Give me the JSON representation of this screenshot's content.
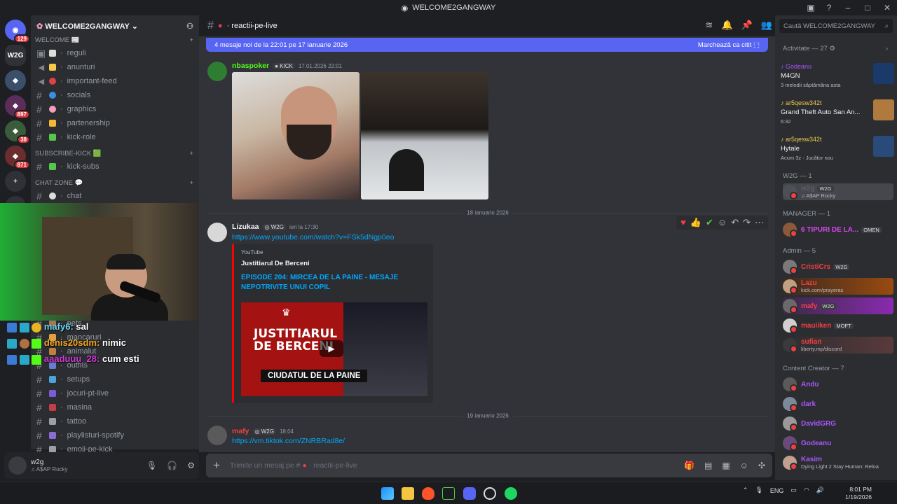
{
  "window": {
    "title": "WELCOME2GANGWAY"
  },
  "rail": {
    "badges": [
      "129",
      "897",
      "38",
      "871"
    ]
  },
  "server": {
    "name": "WELCOME2GANGWAY"
  },
  "categories": [
    {
      "name": "WELCOME 📰",
      "channels": [
        "reguli",
        "anunturi",
        "important-feed",
        "socials",
        "graphics",
        "partenership",
        "kick-role"
      ]
    },
    {
      "name": "SUBSCRIBE-KICK 🟩",
      "channels": [
        "kick-subs"
      ]
    },
    {
      "name": "CHAT ZONE 💬",
      "channels": [
        "chat"
      ]
    },
    {
      "name": "",
      "channels": [
        "pets",
        "mancaruri",
        "animalut",
        "outfits",
        "setups",
        "jocuri-pt-live",
        "masina",
        "tattoo",
        "playlisturi-spotify",
        "emoji-pe-kick"
      ]
    }
  ],
  "stream_chat": [
    {
      "user": "mafy6:",
      "text": "sal"
    },
    {
      "user": "denis20sdm:",
      "text": "nimic"
    },
    {
      "user": "aaaduuu_28:",
      "text": "cum esti"
    }
  ],
  "user_panel": {
    "name": "w2g",
    "status": "A$AP Rocky"
  },
  "channel": {
    "name": "reactii-pe-live"
  },
  "new_bar": {
    "text": "4 mesaje noi de la 22:01 pe 17 ianuarie 2026",
    "action": "Marchează ca citit"
  },
  "messages": [
    {
      "user": "nbaspoker",
      "tag": "KICK",
      "time": "17.01.2026 22:01"
    },
    {
      "divider": "18 ianuarie 2026"
    },
    {
      "user": "Lizukaa",
      "tag": "W2G",
      "time": "ieri la 17:30",
      "link": "https://www.youtube.com/watch?v=FSk5dNgp0eo",
      "embed": {
        "provider": "YouTube",
        "author": "Justitiarul De Berceni",
        "title": "EPISODE 204: MIRCEA DE LA PAINE - MESAJE NEPOTRIVITE UNUI COPIL",
        "thumb_title": "JUSTITIARUL DE BERCENI",
        "thumb_caption": "CIUDATUL DE LA PAINE"
      }
    },
    {
      "divider": "19 ianuarie 2026"
    },
    {
      "user": "mafy",
      "tag": "W2G",
      "time": "18:04",
      "link": "https://vm.tiktok.com/ZNRBRad8e/"
    }
  ],
  "input": {
    "placeholder_prefix": "Trimite un mesaj pe #",
    "placeholder_channel": "· reactii-pe-live"
  },
  "members": {
    "search_placeholder": "Caută WELCOME2GANGWAY",
    "activity_header": "Activitate — 27",
    "activities": [
      {
        "user": "Godeanu",
        "title": "M4GN",
        "sub": "3 melodii săptămâna asta"
      },
      {
        "user": "ar5qesw342t",
        "title": "Grand Theft Auto San An...",
        "sub": "6:32"
      },
      {
        "user": "ar5qesw342t",
        "title": "Hytale",
        "sub": "Acum 3z · Jucător nou"
      }
    ],
    "sections": [
      {
        "header": "W2G — 1",
        "items": [
          {
            "name": "w2g",
            "tag": "W2G",
            "status": "A$AP Rocky",
            "color": "#5c5e66"
          }
        ]
      },
      {
        "header": "MANAGER — 1",
        "items": [
          {
            "name": "6 TIPURI DE LA...",
            "tag": "OMEN",
            "status": "",
            "color": "#d946ef"
          }
        ]
      },
      {
        "header": "Admin — 5",
        "items": [
          {
            "name": "CristiCrs",
            "tag": "W2G",
            "status": "",
            "color": "#f23f43"
          },
          {
            "name": "Lazu",
            "tag": "",
            "status": "kick.com/prayeras",
            "color": "#f23f43"
          },
          {
            "name": "mafy",
            "tag": "W2G",
            "status": "",
            "color": "#f23f43"
          },
          {
            "name": "mauiiken",
            "tag": "MOFT",
            "status": "",
            "color": "#f23f43"
          },
          {
            "name": "sufian",
            "tag": "",
            "status": "liberty.mp/discord",
            "color": "#f23f43"
          }
        ]
      },
      {
        "header": "Content Creator — 7",
        "items": [
          {
            "name": "Andu",
            "tag": "",
            "status": "",
            "color": "#a855f7"
          },
          {
            "name": "dark",
            "tag": "",
            "status": "",
            "color": "#a855f7"
          },
          {
            "name": "DavidGRG",
            "tag": "",
            "status": "",
            "color": "#a855f7"
          },
          {
            "name": "Godeanu",
            "tag": "",
            "status": "",
            "color": "#a855f7"
          },
          {
            "name": "Kasim",
            "tag": "",
            "status": "Dying Light 2 Stay Human: Reloa",
            "color": "#a855f7"
          }
        ]
      }
    ]
  },
  "taskbar": {
    "lang": "ENG",
    "time": "8:01 PM",
    "date": "1/19/2026"
  },
  "colors": {
    "accent": "#5865f2",
    "kick": "#53fc18",
    "link": "#00a8fc"
  }
}
